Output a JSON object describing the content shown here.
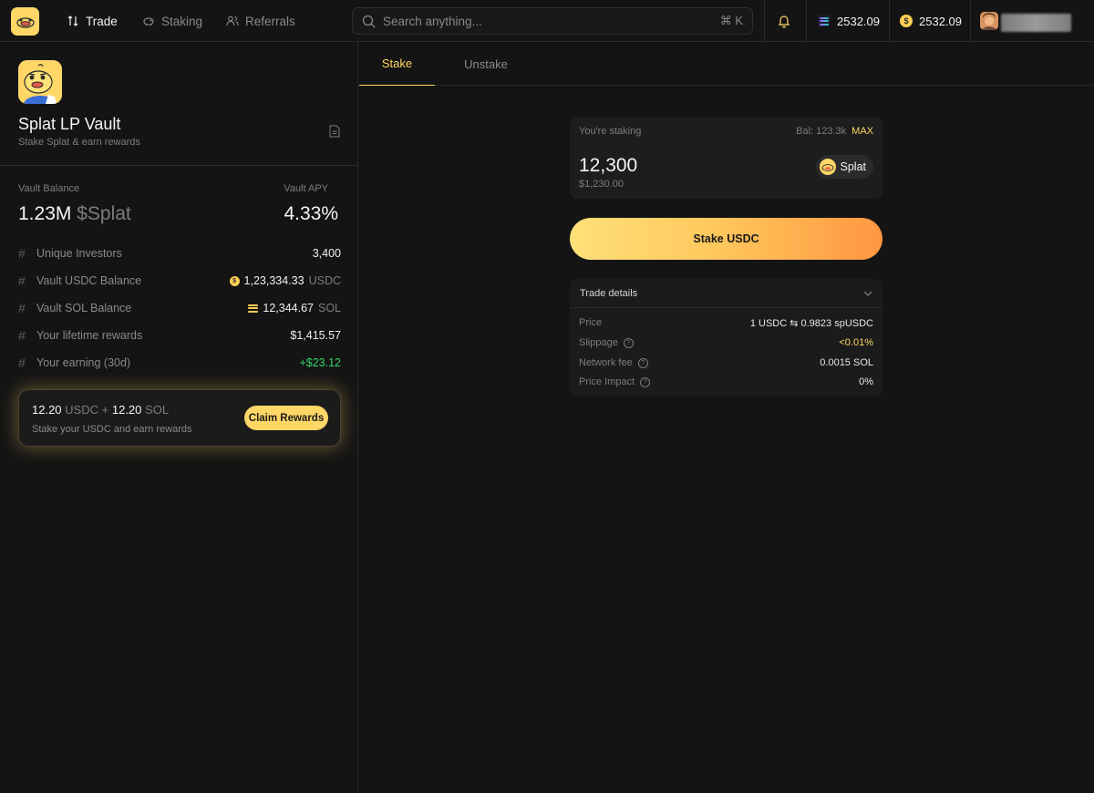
{
  "header": {
    "nav": [
      {
        "label": "Trade",
        "icon": "trade-icon",
        "active": true
      },
      {
        "label": "Staking",
        "icon": "piggy-bank-icon",
        "active": false
      },
      {
        "label": "Referrals",
        "icon": "users-icon",
        "active": false
      }
    ],
    "search": {
      "placeholder": "Search anything...",
      "value": "",
      "shortcut": "⌘ K"
    },
    "balances": [
      {
        "coin": "SOL",
        "icon": "sol-icon",
        "amount": "2532.09"
      },
      {
        "coin": "USDC",
        "icon": "usdc-icon",
        "amount": "2532.09"
      }
    ]
  },
  "vault": {
    "title": "Splat LP Vault",
    "subtitle": "Stake Splat & earn rewards",
    "balance_label": "Vault Balance",
    "balance_value": "1.23M",
    "balance_unit": "$Splat",
    "apy_label": "Vault APY",
    "apy_value": "4.33%",
    "stats": [
      {
        "label": "Unique Investors",
        "value": "3,400",
        "unit": ""
      },
      {
        "label": "Vault USDC Balance",
        "value": "1,23,334.33",
        "unit": "USDC"
      },
      {
        "label": "Vault SOL Balance",
        "value": "12,344.67",
        "unit": "SOL"
      },
      {
        "label": "Your lifetime rewards",
        "value": "$1,415.57",
        "unit": ""
      },
      {
        "label": "Your earning (30d)",
        "value": "+$23.12",
        "unit": ""
      }
    ],
    "hash_symbol": "#"
  },
  "rewards": {
    "usdc_amount": "12.20",
    "usdc_unit": "USDC",
    "plus": "+",
    "sol_amount": "12.20",
    "sol_unit": "SOL",
    "subtitle": "Stake your USDC and earn rewards",
    "button": "Claim Rewards"
  },
  "tabs": [
    {
      "label": "Stake",
      "active": true
    },
    {
      "label": "Unstake",
      "active": false
    }
  ],
  "stake": {
    "label": "You're staking",
    "balance": "Bal: 123.3k",
    "max": "MAX",
    "amount": "12,300",
    "usd": "$1,230.00",
    "token": "Splat",
    "button": "Stake USDC"
  },
  "details": {
    "title": "Trade details",
    "rows": [
      {
        "label": "Price",
        "value": "1 USDC ⇆ 0.9823 spUSDC",
        "help": false
      },
      {
        "label": "Slippage",
        "value": "<0.01%",
        "help": true
      },
      {
        "label": "Network fee",
        "value": "0.0015 SOL",
        "help": true
      },
      {
        "label": "Price Impact",
        "value": "0%",
        "help": true
      }
    ]
  },
  "colors": {
    "accent": "#ffd766",
    "background": "#141414",
    "positive": "#34d46a",
    "button_gradient_end": "#ff9640"
  }
}
